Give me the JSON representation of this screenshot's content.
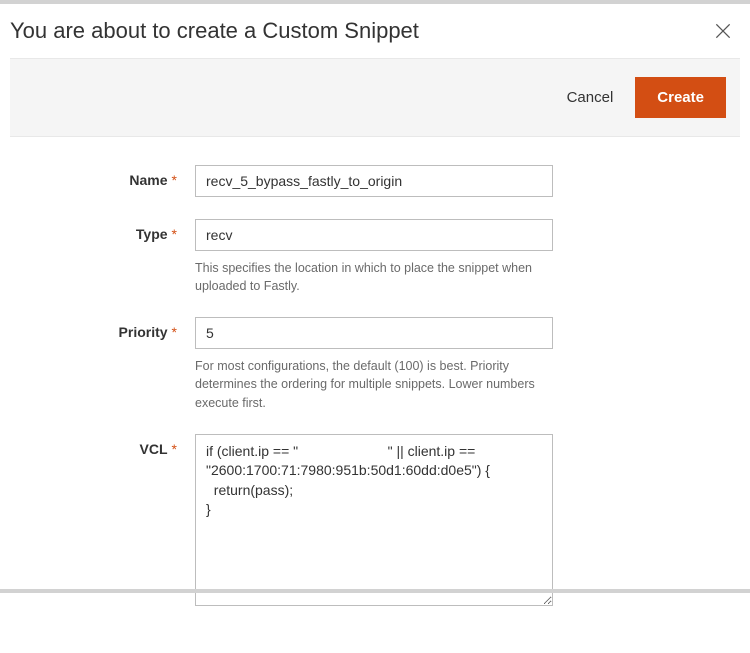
{
  "header": {
    "title": "You are about to create a Custom Snippet"
  },
  "actions": {
    "cancel_label": "Cancel",
    "create_label": "Create"
  },
  "form": {
    "name": {
      "label": "Name",
      "value": "recv_5_bypass_fastly_to_origin"
    },
    "type": {
      "label": "Type",
      "value": "recv",
      "helper": "This specifies the location in which to place the snippet when uploaded to Fastly."
    },
    "priority": {
      "label": "Priority",
      "value": "5",
      "helper": "For most configurations, the default (100) is best. Priority determines the ordering for multiple snippets. Lower numbers execute first."
    },
    "vcl": {
      "label": "VCL",
      "value": "if (client.ip == \"                       \" || client.ip == \"2600:1700:71:7980:951b:50d1:60dd:d0e5\") {\n  return(pass);\n}"
    }
  }
}
